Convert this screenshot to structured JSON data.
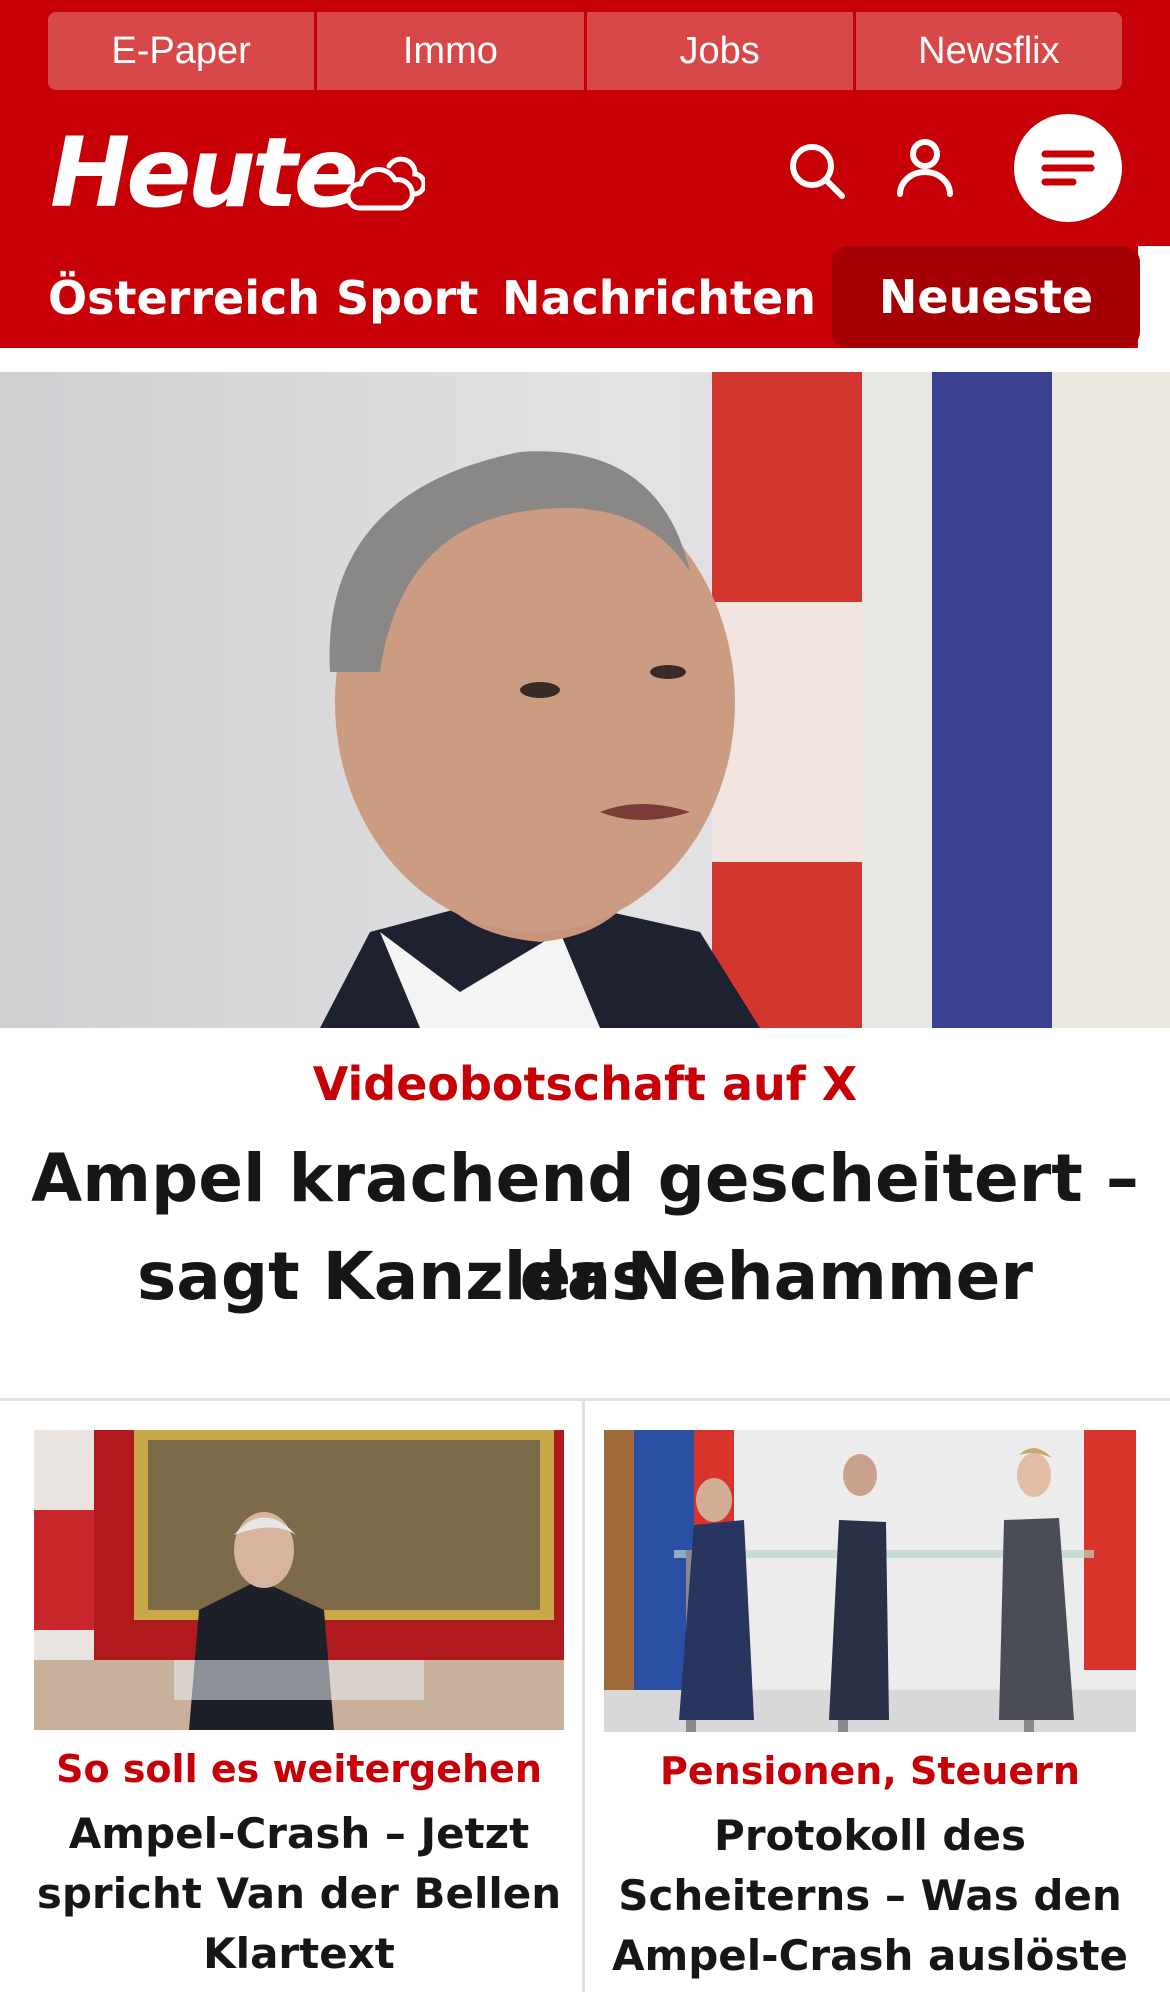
{
  "colors": {
    "brand_red": "#c60006",
    "dark_red": "#a50006",
    "tab_red": "#d94848",
    "text": "#161616",
    "divider": "#e1e1e1"
  },
  "topnav": {
    "items": [
      "E-Paper",
      "Immo",
      "Jobs",
      "Newsflix"
    ]
  },
  "header": {
    "logo": "Heute",
    "icons": [
      "weather-cloud-icon",
      "search-icon",
      "user-icon",
      "menu-icon"
    ]
  },
  "secnav": {
    "items": [
      "Österreich",
      "Sport",
      "Nachrichten"
    ],
    "active": "Neueste"
  },
  "hero": {
    "kicker": "Videobotschaft auf X",
    "headline_line1": "Ampel krachend gescheitert – das",
    "headline_line2": "sagt Kanzler Nehammer"
  },
  "cards": [
    {
      "kicker": "So soll es weitergehen",
      "title_lines": [
        "Ampel-Crash – Jetzt",
        "spricht Van der Bellen",
        "Klartext"
      ]
    },
    {
      "kicker": "Pensionen, Steuern",
      "title_lines": [
        "Protokoll des",
        "Scheiterns – Was den",
        "Ampel-Crash auslöste"
      ]
    }
  ]
}
